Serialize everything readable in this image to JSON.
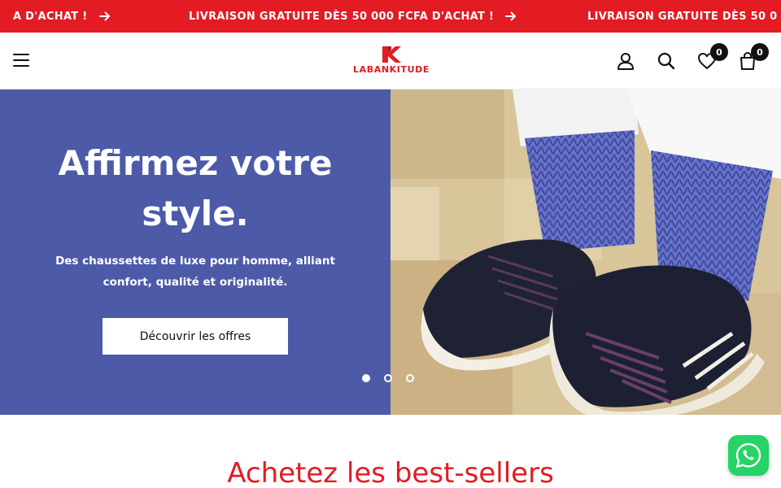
{
  "announcement": {
    "messages": [
      "A D'ACHAT !",
      "LIVRAISON GRATUITE DÈS 50 000 FCFA D'ACHAT !",
      "LIVRAISON GRATUITE DÈS 50 0"
    ],
    "background": "#e31b23"
  },
  "header": {
    "logo_text": "LABANKITUDE",
    "wishlist_count": "0",
    "cart_count": "0",
    "icons": [
      "menu-icon",
      "account-icon",
      "search-icon",
      "heart-icon",
      "bag-icon"
    ]
  },
  "hero": {
    "title": "Affirmez votre\nstyle.",
    "subtitle": "Des chaussettes de luxe pour homme, alliant confort, qualité et originalité.",
    "button_label": "Découvrir les offres",
    "panel_color": "#4d5aa8",
    "slides": 3,
    "active_slide": 1
  },
  "bestsellers": {
    "title": "Achetez les best-sellers"
  },
  "colors": {
    "accent": "#e31b23",
    "whatsapp": "#25d366"
  }
}
